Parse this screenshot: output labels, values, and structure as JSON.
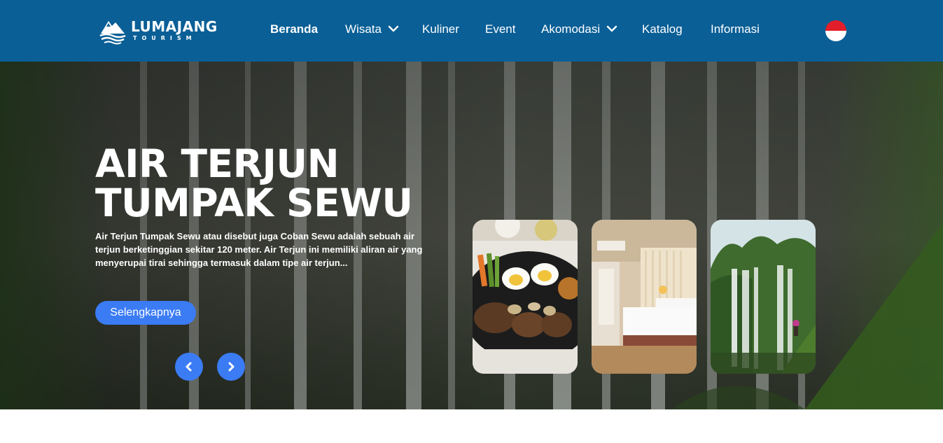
{
  "brand": {
    "name": "LUMAJANG",
    "tagline": "TOURISM",
    "logo_icon": "mountain-waves-logo"
  },
  "nav": {
    "items": [
      {
        "label": "Beranda",
        "active": true,
        "has_dropdown": false
      },
      {
        "label": "Wisata",
        "active": false,
        "has_dropdown": true
      },
      {
        "label": "Kuliner",
        "active": false,
        "has_dropdown": false
      },
      {
        "label": "Event",
        "active": false,
        "has_dropdown": false
      },
      {
        "label": "Akomodasi",
        "active": false,
        "has_dropdown": true
      },
      {
        "label": "Katalog",
        "active": false,
        "has_dropdown": false
      },
      {
        "label": "Informasi",
        "active": false,
        "has_dropdown": false
      }
    ],
    "language_flag": "indonesia-flag-icon"
  },
  "hero": {
    "title": "AIR TERJUN TUMPAK SEWU",
    "description": "Air Terjun Tumpak Sewu atau disebut juga Coban Sewu adalah sebuah air terjun berketinggian sekitar 120 meter. Air Terjun ini memiliki aliran air yang menyerupai tirai sehingga termasuk dalam tipe air terjun...",
    "cta_label": "Selengkapnya",
    "prev_icon": "chevron-left-icon",
    "next_icon": "chevron-right-icon",
    "cards": [
      {
        "name": "kuliner-card",
        "image": "food-plate-image"
      },
      {
        "name": "akomodasi-card",
        "image": "hotel-room-image"
      },
      {
        "name": "wisata-card",
        "image": "waterfall-image"
      }
    ]
  },
  "colors": {
    "navbar": "#0a5f96",
    "accent": "#3b7cf5",
    "flag_red": "#e21e2a",
    "flag_white": "#ffffff"
  }
}
